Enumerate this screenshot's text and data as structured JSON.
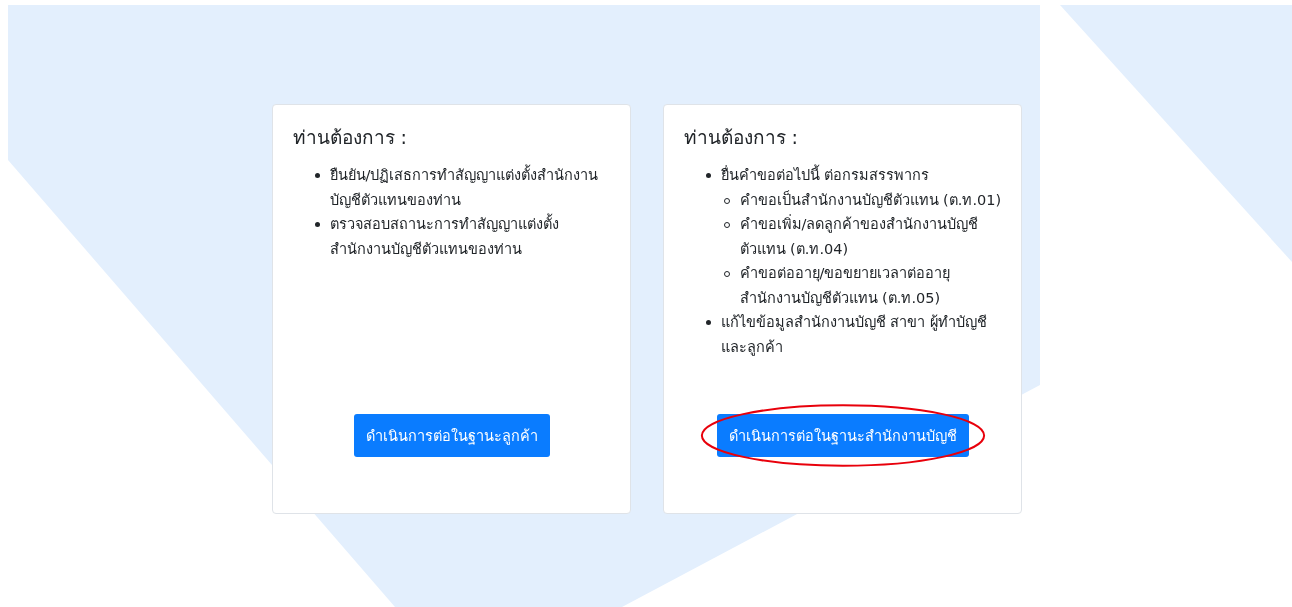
{
  "cards": [
    {
      "title": "ท่านต้องการ :",
      "items": [
        {
          "text": "ยืนยัน/ปฏิเสธการทำสัญญาแต่งตั้งสำนักงานบัญชีตัวแทนของท่าน"
        },
        {
          "text": "ตรวจสอบสถานะการทำสัญญาแต่งตั้งสำนักงานบัญชีตัวแทนของท่าน"
        }
      ],
      "button": {
        "label": "ดำเนินการต่อในฐานะลูกค้า",
        "circled": false
      }
    },
    {
      "title": "ท่านต้องการ :",
      "items": [
        {
          "text": "ยื่นคำขอต่อไปนี้ ต่อกรมสรรพากร",
          "children": [
            {
              "text": "คำขอเป็นสำนักงานบัญชีตัวแทน (ต.ท.01)"
            },
            {
              "text": "คำขอเพิ่ม/ลดลูกค้าของสำนักงานบัญชีตัวแทน (ต.ท.04)"
            },
            {
              "text": "คำขอต่ออายุ/ขอขยายเวลาต่ออายุสำนักงานบัญชีตัวแทน (ต.ท.05)"
            }
          ]
        },
        {
          "text": "แก้ไขข้อมูลสำนักงานบัญชี สาขา ผู้ทำบัญชี และลูกค้า"
        }
      ],
      "button": {
        "label": "ดำเนินการต่อในฐานะสำนักงานบัญชี",
        "circled": true
      }
    }
  ]
}
